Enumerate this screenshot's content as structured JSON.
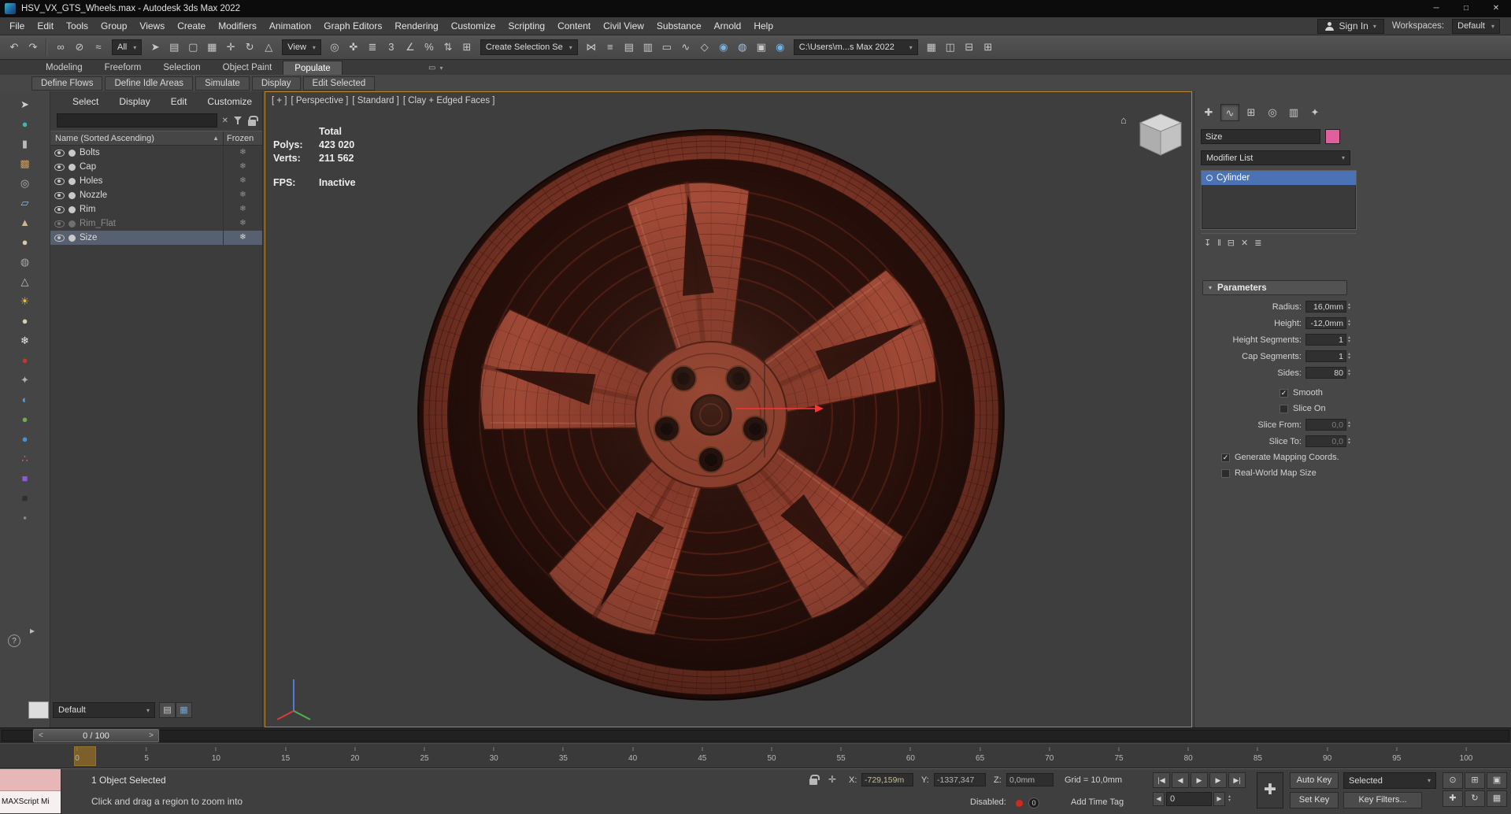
{
  "ui": {
    "caret": "▾",
    "sort_arrow": "▲",
    "check": "✓",
    "snowflake": "❄",
    "close": "✕",
    "spin_up": "▴",
    "spin_down": "▾",
    "slider_prev": "<",
    "slider_next": ">",
    "home": "⌂",
    "expand": "▸",
    "help": "?"
  },
  "window": {
    "title": "HSV_VX_GTS_Wheels.max - Autodesk 3ds Max 2022",
    "controls": [
      {
        "glyph": "─",
        "name": "minimize-button"
      },
      {
        "glyph": "□",
        "name": "maximize-button"
      },
      {
        "glyph": "✕",
        "name": "close-button"
      }
    ]
  },
  "menu": {
    "items": [
      "File",
      "Edit",
      "Tools",
      "Group",
      "Views",
      "Create",
      "Modifiers",
      "Animation",
      "Graph Editors",
      "Rendering",
      "Customize",
      "Scripting",
      "Content",
      "Civil View",
      "Substance",
      "Arnold",
      "Help"
    ],
    "sign_in": "Sign In",
    "workspaces_label": "Workspaces:",
    "workspace": "Default"
  },
  "toolbar": {
    "icons_a": [
      {
        "glyph": "↶",
        "name": "undo-icon"
      },
      {
        "glyph": "↷",
        "name": "redo-icon"
      }
    ],
    "icons_b": [
      {
        "glyph": "∞",
        "name": "select-and-link-icon"
      },
      {
        "glyph": "⊘",
        "name": "unlink-selection-icon"
      },
      {
        "glyph": "≈",
        "name": "bind-to-space-warp-icon"
      }
    ],
    "filter_value": "All",
    "icons_c": [
      {
        "glyph": "➤",
        "name": "select-object-icon"
      },
      {
        "glyph": "▤",
        "name": "select-by-name-icon"
      },
      {
        "glyph": "▢",
        "name": "rectangular-selection-icon"
      },
      {
        "glyph": "▦",
        "name": "window-crossing-icon"
      },
      {
        "glyph": "✛",
        "name": "select-and-move-icon"
      },
      {
        "glyph": "↻",
        "name": "select-and-rotate-icon"
      },
      {
        "glyph": "△",
        "name": "select-and-scale-icon"
      }
    ],
    "coord_value": "View",
    "icons_d": [
      {
        "glyph": "◎",
        "name": "use-pivot-center-icon"
      },
      {
        "glyph": "✜",
        "name": "select-and-manipulate-icon"
      },
      {
        "glyph": "≣",
        "name": "keyboard-override-icon"
      },
      {
        "glyph": "3",
        "name": "snaps-toggle-icon"
      },
      {
        "glyph": "∠",
        "name": "angle-snap-icon"
      },
      {
        "glyph": "%",
        "name": "percent-snap-icon"
      },
      {
        "glyph": "⇅",
        "name": "spinner-snap-icon"
      },
      {
        "glyph": "⊞",
        "name": "named-selection-sets-icon"
      }
    ],
    "selection_set_value": "Create Selection Se",
    "icons_e": [
      {
        "glyph": "⋈",
        "name": "mirror-icon"
      },
      {
        "glyph": "≡",
        "name": "align-icon"
      },
      {
        "glyph": "▤",
        "name": "scene-explorer-toggle-icon"
      },
      {
        "glyph": "▥",
        "name": "layer-explorer-toggle-icon"
      },
      {
        "glyph": "▭",
        "name": "ribbon-toggle-icon"
      },
      {
        "glyph": "∿",
        "name": "curve-editor-icon"
      },
      {
        "glyph": "◇",
        "name": "schematic-view-icon"
      },
      {
        "glyph": "◉",
        "name": "material-editor-icon",
        "color": "#7fb0d8"
      },
      {
        "glyph": "◍",
        "name": "render-setup-icon",
        "color": "#9fc0e0"
      },
      {
        "glyph": "▣",
        "name": "rendered-frame-icon"
      },
      {
        "glyph": "◉",
        "name": "render-production-icon",
        "color": "#6fb2e8"
      }
    ],
    "path_value": "C:\\Users\\m...s Max 2022",
    "icons_f": [
      {
        "glyph": "▦",
        "name": "project-folder-icon"
      },
      {
        "glyph": "◫",
        "name": "asset-tracking-icon"
      },
      {
        "glyph": "⊟",
        "name": "window-layout-icon"
      },
      {
        "glyph": "⊞",
        "name": "new-window-icon"
      }
    ]
  },
  "ribbon": {
    "tabs": [
      {
        "label": "Modeling",
        "active": false
      },
      {
        "label": "Freeform",
        "active": false
      },
      {
        "label": "Selection",
        "active": false
      },
      {
        "label": "Object Paint",
        "active": false
      },
      {
        "label": "Populate",
        "active": true
      }
    ],
    "menu_glyph": "▭",
    "tools": [
      {
        "label": "Define Flows"
      },
      {
        "label": "Define Idle Areas"
      },
      {
        "label": "Simulate"
      },
      {
        "label": "Display"
      },
      {
        "label": "Edit Selected"
      }
    ]
  },
  "left_strip": {
    "icons": [
      {
        "glyph": "➤",
        "color": "#cfcfcf",
        "name": "select-tool-icon"
      },
      {
        "glyph": "●",
        "color": "#3fb6ae",
        "name": "teal-sphere-tool-icon"
      },
      {
        "glyph": "▮",
        "color": "#b9b9b9",
        "name": "cylinder-tool-icon"
      },
      {
        "glyph": "▩",
        "color": "#c89a5a",
        "name": "box-tool-icon"
      },
      {
        "glyph": "◎",
        "color": "#b5b5b5",
        "name": "torus-tool-icon"
      },
      {
        "glyph": "▱",
        "color": "#9ab6d8",
        "name": "plane-tool-icon"
      },
      {
        "glyph": "▲",
        "color": "#c9b896",
        "name": "cone-tool-icon"
      },
      {
        "glyph": "●",
        "color": "#d9c9a0",
        "name": "sphere-tool-icon"
      },
      {
        "glyph": "◍",
        "color": "#a8a8a8",
        "name": "tube-tool-icon"
      },
      {
        "glyph": "△",
        "color": "#c0c0c0",
        "name": "pyramid-tool-icon"
      },
      {
        "glyph": "☀",
        "color": "#f0c040",
        "name": "light-tool-icon"
      },
      {
        "glyph": "●",
        "color": "#d8cdb0",
        "name": "geosphere-tool-icon"
      },
      {
        "glyph": "❄",
        "color": "#e8e8e8",
        "name": "snow-tool-icon"
      },
      {
        "glyph": "●",
        "color": "#c0392b",
        "name": "drop-tool-icon"
      },
      {
        "glyph": "✦",
        "color": "#b0b0b0",
        "name": "star-tool-icon"
      },
      {
        "glyph": "◐",
        "color": "#5a9bd4",
        "name": "earth-tool-icon"
      },
      {
        "glyph": "●",
        "color": "#6ab04c",
        "name": "green-sphere-tool-icon"
      },
      {
        "glyph": "●",
        "color": "#4a90d9",
        "name": "blue-sphere-tool-icon"
      },
      {
        "glyph": "∴",
        "color": "#d46a9e",
        "name": "particles-tool-icon"
      },
      {
        "glyph": "■",
        "color": "#8e5ad4",
        "name": "container-tool-icon"
      },
      {
        "glyph": "■",
        "color": "#2f2f2f",
        "name": "dark-box-tool-icon"
      },
      {
        "glyph": "▪",
        "color": "#8a8a8a",
        "name": "small-box-tool-icon"
      }
    ]
  },
  "scene_explorer": {
    "menus": [
      "Select",
      "Display",
      "Edit",
      "Customize"
    ],
    "sort_column": "Name (Sorted Ascending)",
    "frozen_column": "Frozen",
    "rows": [
      {
        "name": "Bolts",
        "state": "normal"
      },
      {
        "name": "Cap",
        "state": "normal"
      },
      {
        "name": "Holes",
        "state": "normal"
      },
      {
        "name": "Nozzle",
        "state": "normal"
      },
      {
        "name": "Rim",
        "state": "normal"
      },
      {
        "name": "Rim_Flat",
        "state": "dimmed"
      },
      {
        "name": "Size",
        "state": "selected"
      }
    ],
    "layer_value": "Default",
    "layer_icons": [
      {
        "glyph": "▤",
        "name": "layers-stack-icon"
      },
      {
        "glyph": "▦",
        "name": "layer-grid-icon",
        "color": "#6fa3d8"
      }
    ]
  },
  "viewport": {
    "segments": [
      "[ + ]",
      "[ Perspective ]",
      "[ Standard ]",
      "[ Clay + Edged Faces ]"
    ],
    "stats": {
      "total": "Total",
      "polys_label": "Polys:",
      "polys": "423 020",
      "verts_label": "Verts:",
      "verts": "211 562",
      "fps_label": "FPS:",
      "fps": "Inactive"
    },
    "wheel": {
      "colors": {
        "barrel": "#2a100b",
        "ring": "#8a3b2a",
        "line": "#47170f",
        "window": "#29100b",
        "spoke_light": "#a84e3a",
        "spoke_dark": "#7c3325",
        "hub": "#8a3c2b",
        "lug": "#1a0a07",
        "bore": "#2b120c",
        "gizmo_x": "#ff3333"
      }
    }
  },
  "timeline": {
    "slider_value": "0 / 100",
    "ticks": [
      "0",
      "5",
      "10",
      "15",
      "20",
      "25",
      "30",
      "35",
      "40",
      "45",
      "50",
      "55",
      "60",
      "65",
      "70",
      "75",
      "80",
      "85",
      "90",
      "95",
      "100"
    ]
  },
  "status": {
    "maxscript_label": "MAXScript Mi",
    "selection": "1 Object Selected",
    "prompt": "Click and drag a region to zoom into",
    "abs_glyph": "✛",
    "x_label": "X:",
    "x": "-729,159m",
    "y_label": "Y:",
    "y": "-1337,347",
    "z_label": "Z:",
    "z": "0,0mm",
    "grid": "Grid = 10,0mm",
    "disabled_label": "Disabled:",
    "counter": "0",
    "add_time_tag": "Add Time Tag",
    "playback": [
      {
        "glyph": "|◀",
        "name": "go-to-start-button"
      },
      {
        "glyph": "◀",
        "name": "previous-frame-button"
      },
      {
        "glyph": "▶",
        "name": "play-button"
      },
      {
        "glyph": "▶",
        "name": "next-frame-button"
      },
      {
        "glyph": "▶|",
        "name": "go-to-end-button"
      }
    ],
    "frame_prev_glyph": "◀",
    "frame_next_glyph": "▶",
    "frame": "0",
    "key_glyph": "✚",
    "auto_key": "Auto Key",
    "set_key": "Set Key",
    "selected": "Selected",
    "key_filters": "Key Filters...",
    "nav": [
      {
        "glyph": "⊙",
        "name": "zoom-icon"
      },
      {
        "glyph": "⊞",
        "name": "zoom-all-icon"
      },
      {
        "glyph": "▣",
        "name": "zoom-extents-icon"
      },
      {
        "glyph": "✚",
        "name": "pan-icon"
      },
      {
        "glyph": "↻",
        "name": "orbit-icon"
      },
      {
        "glyph": "▦",
        "name": "maximize-viewport-icon"
      }
    ]
  },
  "command_panel": {
    "tabs": [
      {
        "glyph": "✚",
        "name": "create-tab",
        "active": false
      },
      {
        "glyph": "∿",
        "name": "modify-tab",
        "active": true
      },
      {
        "glyph": "⊞",
        "name": "hierarchy-tab",
        "active": false
      },
      {
        "glyph": "◎",
        "name": "motion-tab",
        "active": false
      },
      {
        "glyph": "▥",
        "name": "display-tab",
        "active": false
      },
      {
        "glyph": "✦",
        "name": "utilities-tab",
        "active": false
      }
    ],
    "object_name": "Size",
    "color_swatch": "#e0609e",
    "modifier_list": "Modifier List",
    "stack": [
      {
        "label": "Cylinder",
        "selected": true
      }
    ],
    "stack_tools": [
      {
        "glyph": "↧",
        "name": "pin-stack-icon"
      },
      {
        "glyph": "‖",
        "name": "show-end-result-icon"
      },
      {
        "glyph": "⊟",
        "name": "make-unique-icon"
      },
      {
        "glyph": "✕",
        "name": "remove-modifier-icon"
      },
      {
        "glyph": "≣",
        "name": "configure-modifier-sets-icon"
      }
    ],
    "rollout_title": "Parameters",
    "params": [
      {
        "label": "Radius:",
        "value": "16,0mm"
      },
      {
        "label": "Height:",
        "value": "-12,0mm"
      },
      {
        "label": "Height Segments:",
        "value": "1"
      },
      {
        "label": "Cap Segments:",
        "value": "1"
      },
      {
        "label": "Sides:",
        "value": "80"
      }
    ],
    "checks_a": [
      {
        "label": "Smooth",
        "checked": true
      },
      {
        "label": "Slice On",
        "checked": false
      }
    ],
    "slice_params": [
      {
        "label": "Slice From:",
        "value": "0,0",
        "disabled": true
      },
      {
        "label": "Slice To:",
        "value": "0,0",
        "disabled": true
      }
    ],
    "checks_b": [
      {
        "label": "Generate Mapping Coords.",
        "checked": true
      },
      {
        "label": "Real-World Map Size",
        "checked": false
      }
    ]
  }
}
